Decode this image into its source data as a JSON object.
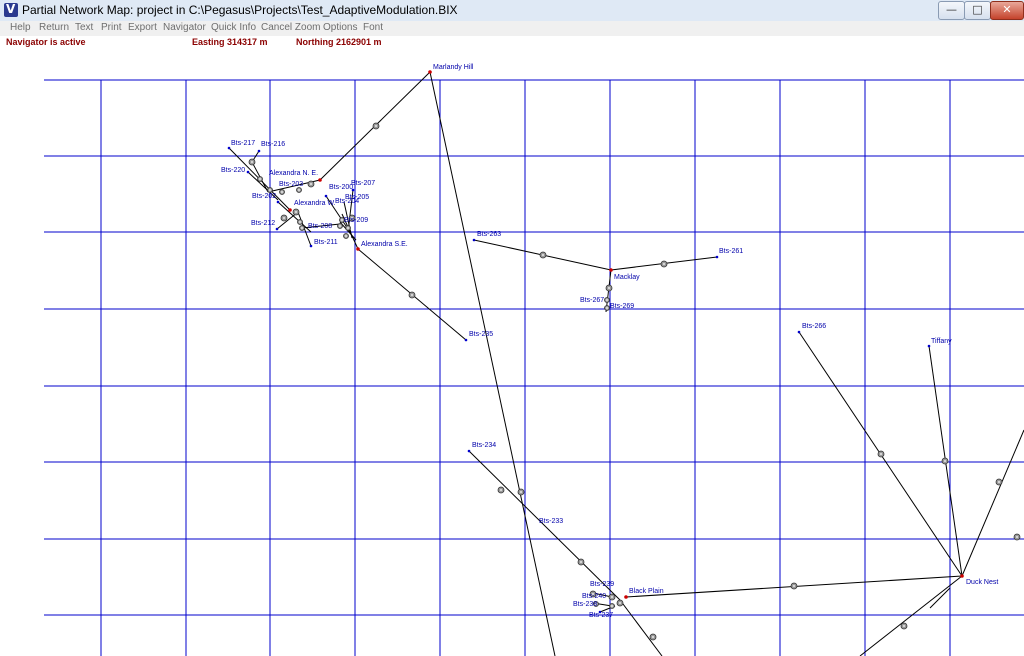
{
  "window": {
    "title": "Partial Network Map: project in C:\\Pegasus\\Projects\\Test_AdaptiveModulation.BIX"
  },
  "titlebar_buttons": {
    "minimize": "—",
    "maximize": "□",
    "close": "✕"
  },
  "menu": [
    "Help",
    "Return",
    "Text",
    "Print",
    "Export",
    "Navigator",
    "Quick Info",
    "Cancel Zoom",
    "Options",
    "Font"
  ],
  "status": {
    "navigator": "Navigator is active",
    "easting": "Easting 314317 m",
    "northing": "Northing 2162901 m"
  },
  "colors": {
    "grid": "#0000cd",
    "label": "#0000aa",
    "status": "#8b0000",
    "site": "#cc0000"
  },
  "map": {
    "sites": [
      {
        "name": "Marlandy Hill"
      },
      {
        "name": "Alexandra N. E."
      },
      {
        "name": "Alexandra W."
      },
      {
        "name": "Alexandra S.E."
      },
      {
        "name": "Macklay"
      },
      {
        "name": "Black Plain"
      },
      {
        "name": "Duck Nest"
      },
      {
        "name": "Tiffany"
      }
    ],
    "stations": [
      "Bts-217",
      "Bts-216",
      "Bts-220",
      "Bts-203",
      "Bts-202",
      "Bts-200",
      "Bts-207",
      "Bts-204",
      "Bts-205",
      "Bts-212",
      "Bts-208",
      "Bts-209",
      "Bts-211",
      "Bts-263",
      "Bts-261",
      "Bts-267",
      "Bts-269",
      "Bts-235",
      "Bts-266",
      "Bts-234",
      "Bts-233",
      "Bts-239",
      "Bts-240",
      "Bts-238",
      "Bts-237"
    ]
  }
}
